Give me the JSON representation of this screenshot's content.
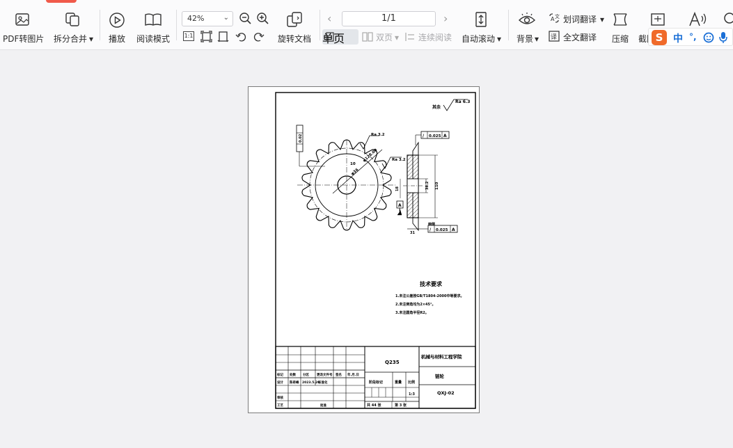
{
  "toolbar": {
    "pdf_to_image": "PDF转图片",
    "split_merge": "拆分合并",
    "play": "播放",
    "read_mode": "阅读模式",
    "zoom_value": "42%",
    "rotate_doc": "旋转文档",
    "page_indicator": "1/1",
    "single_page": "单页",
    "double_page": "双页",
    "continuous": "连续阅读",
    "auto_scroll": "自动滚动",
    "background": "背景",
    "word_translate": "划词翻译",
    "full_translate": "全文翻译",
    "compress": "压缩",
    "screenshot": "截图",
    "fit_label": "1:1"
  },
  "ime": {
    "logo": "S",
    "lang": "中",
    "punct": "°,"
  },
  "drawing": {
    "roughness_top": "其余",
    "roughness_val": "Ra 6.3",
    "ra32_a": "Ra 3.2",
    "ra32_b": "Ra 3.2",
    "tol_a": "0.025",
    "datum_a": "A",
    "tol_b": "0.025",
    "datum_b": "A",
    "tol_left": "0.02",
    "dim_phi": "φ128.00",
    "dim_10": "10",
    "dim_36": "φ36",
    "dim_110": "110",
    "dim_31": "31",
    "dim_18": "18",
    "dim_382": "38.2",
    "datum_label": "A",
    "tech_title": "技术要求",
    "tech_1": "1.未注公差按GB/T1804-2000中等要求。",
    "tech_2": "2.未注倒角均为2×45°。",
    "tech_3": "3.未注圆角半径R2。",
    "material": "Q235",
    "school": "机械与材料工程学院",
    "part_name": "链轮",
    "drawing_no": "QXJ-02",
    "scale": "1:3",
    "sheet_total": "共 44 张",
    "sheet_no": "第 3 张",
    "col_mark": "标记",
    "col_count": "处数",
    "col_zone": "分区",
    "col_change": "更改文件号",
    "col_sign": "签名",
    "col_date": "年.月.日",
    "row_design": "设计",
    "designer": "陈奇峰",
    "design_date": "2023.5.20",
    "row_std": "标准化",
    "row_review": "审核",
    "row_process": "工艺",
    "row_approve": "批准",
    "stage_mark": "阶段标记",
    "weight": "重量",
    "scale_label": "比例",
    "surface_note": "两侧"
  },
  "colors": {
    "accent": "#f05a4a",
    "ime_blue": "#1a6fd6"
  }
}
